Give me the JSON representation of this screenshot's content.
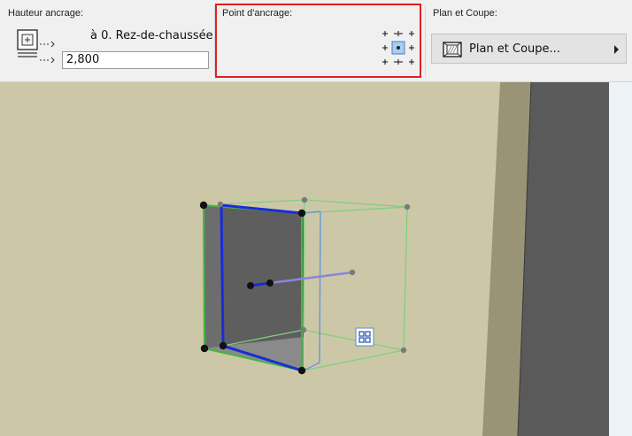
{
  "toolbar": {
    "anchor_height": {
      "label": "Hauteur ancrage:",
      "story": "à 0. Rez-de-chaussée",
      "value": "2,800"
    },
    "anchor_point": {
      "label": "Point d'ancrage:",
      "selected_point": "center"
    },
    "plan_section": {
      "label": "Plan et Coupe:",
      "button_label": "Plan et Coupe..."
    }
  },
  "colors": {
    "toolbar_bg": "#f0f0f0",
    "highlight": "#e02020",
    "wall": "#ccc8a7",
    "column_dark": "#5a5a5a",
    "selection_blue": "#1a2bd8",
    "outline_green": "#3fb83f",
    "box_face": "#7a7a7a"
  },
  "icons": {
    "anchor_height": "anchor-height-icon",
    "anchor_grid": "anchor-point-grid-icon",
    "plan_section": "plan-section-icon",
    "submenu_arrow": "chevron-right-icon",
    "editing_handle": "pet-palette-icon"
  }
}
